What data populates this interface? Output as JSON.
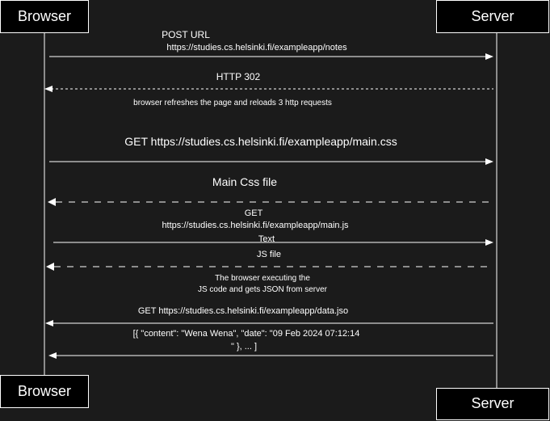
{
  "actors": {
    "browser": {
      "top_label": "Browser",
      "bottom_label": "Browser"
    },
    "server": {
      "top_label": "Server",
      "bottom_label": "Server"
    }
  },
  "messages": [
    {
      "id": "post-url",
      "from": "browser",
      "to": "server",
      "style": "solid",
      "lines": [
        "POST URL",
        "https://studies.cs.helsinki.fi/exampleapp/notes"
      ]
    },
    {
      "id": "http-302",
      "from": "server",
      "to": "browser",
      "style": "dotted",
      "lines": [
        "HTTP 302"
      ]
    },
    {
      "id": "get-main-css",
      "from": "browser",
      "to": "server",
      "style": "solid",
      "lines": [
        "GET  https://studies.cs.helsinki.fi/exampleapp/main.css"
      ]
    },
    {
      "id": "main-css-file",
      "from": "server",
      "to": "browser",
      "style": "dashed",
      "lines": [
        "Main Css file"
      ]
    },
    {
      "id": "get-main-js",
      "from": "browser",
      "to": "server",
      "style": "solid",
      "lines": [
        "GET",
        "https://studies.cs.helsinki.fi/exampleapp/main.js"
      ],
      "below": [
        "Text"
      ]
    },
    {
      "id": "js-file",
      "from": "server",
      "to": "browser",
      "style": "dashed",
      "lines": [
        "JS file"
      ]
    },
    {
      "id": "get-data-json",
      "from": "server",
      "to": "browser",
      "style": "solid",
      "lines": [
        "GET https://studies.cs.helsinki.fi/exampleapp/data.jso"
      ]
    },
    {
      "id": "json-response",
      "from": "server",
      "to": "browser",
      "style": "solid",
      "lines": [
        "[{ \"content\": \"Wena Wena\", \"date\": \"09 Feb 2024 07:12:14",
        "\" }, ... ]"
      ]
    }
  ],
  "notes": [
    {
      "id": "note-refresh",
      "lines": [
        "browser refreshes the page and reloads 3 http requests"
      ]
    },
    {
      "id": "note-executing",
      "lines": [
        "The browser executing the",
        "JS code and gets JSON from server"
      ]
    }
  ]
}
